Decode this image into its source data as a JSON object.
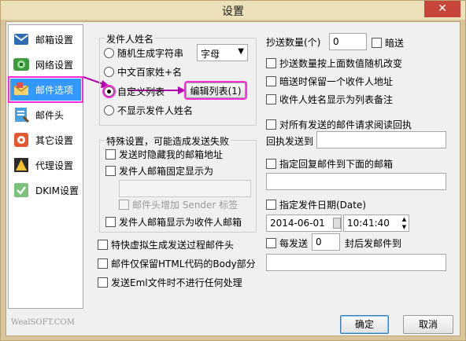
{
  "window": {
    "title": "设置",
    "close_glyph": "✕"
  },
  "sidebar": {
    "items": [
      {
        "label": "邮箱设置",
        "icon": "mailbox-icon"
      },
      {
        "label": "网络设置",
        "icon": "network-icon"
      },
      {
        "label": "邮件选项",
        "icon": "mail-options-icon",
        "selected": true
      },
      {
        "label": "邮件头",
        "icon": "mail-header-icon"
      },
      {
        "label": "其它设置",
        "icon": "other-settings-icon"
      },
      {
        "label": "代理设置",
        "icon": "proxy-icon"
      },
      {
        "label": "DKIM设置",
        "icon": "dkim-icon"
      }
    ],
    "watermark": "WealSOFT.COM"
  },
  "sender_name": {
    "group_title": "发件人姓名",
    "random_label": "随机生成字符串",
    "random_type_value": "字母",
    "chinese_name_label": "中文百家姓+名",
    "custom_list_label": "自定义列表",
    "edit_list_button": "编辑列表(1)",
    "hide_name_label": "不显示发件人姓名",
    "selected": "custom_list"
  },
  "special": {
    "group_title": "特殊设置，可能造成发送失败",
    "hide_address": "发送时隐藏我的邮箱地址",
    "fixed_sender": "发件人邮箱固定显示为",
    "fixed_sender_value": "",
    "sender_header": "邮件头增加 Sender 标签",
    "sender_as_receiver": "发件人邮箱显示为收件人邮箱"
  },
  "misc": {
    "fake_header": "特快虚拟生成发送过程邮件头",
    "html_body_only": "邮件仅保留HTML代码的Body部分",
    "eml_no_process": "发送Eml文件时不进行任何处理"
  },
  "cc": {
    "count_label": "抄送数量(个)",
    "count_value": "0",
    "bcc_label": "暗送",
    "random_count": "抄送数量按上面数值随机改变",
    "keep_one": "暗送时保留一个收件人地址",
    "show_list_note": "收件人姓名显示为列表备注"
  },
  "receipt": {
    "label_line1": "对所有发送的邮件请求阅读回执",
    "label_line2": "回执发送到",
    "value": ""
  },
  "reply": {
    "label": "指定回复邮件到下面的邮箱",
    "value": ""
  },
  "send_date": {
    "label": "指定发件日期(Date)",
    "date_value": "2014-06-01",
    "time_value": "10:41:40"
  },
  "repeat": {
    "prefix": "每发送",
    "count_value": "0",
    "suffix": "封后发邮件到",
    "value": ""
  },
  "buttons": {
    "ok": "确定",
    "cancel": "取消"
  }
}
